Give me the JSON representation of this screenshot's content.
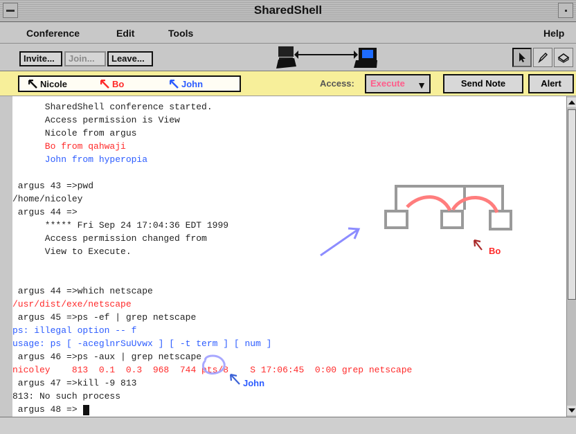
{
  "window": {
    "title": "SharedShell"
  },
  "menu": {
    "items": [
      "Conference",
      "Edit",
      "Tools",
      "Help"
    ]
  },
  "toolbar": {
    "buttons": [
      "Invite...",
      "Join...",
      "Leave..."
    ]
  },
  "participants": [
    {
      "name": "Nicole",
      "color": "#111111"
    },
    {
      "name": "Bo",
      "color": "#ff2a2a"
    },
    {
      "name": "John",
      "color": "#2c5cff"
    }
  ],
  "access": {
    "label": "Access:",
    "value": "Execute"
  },
  "buttons": {
    "send_note": "Send Note",
    "alert": "Alert"
  },
  "terminal": {
    "lines": [
      {
        "text": "      SharedShell conference started.",
        "color": "#222222"
      },
      {
        "text": "      Access permission is View",
        "color": "#222222"
      },
      {
        "text": "      Nicole from argus",
        "color": "#222222"
      },
      {
        "text": "      Bo from qahwaji",
        "color": "#ff2a2a"
      },
      {
        "text": "      John from hyperopia",
        "color": "#2c5cff"
      },
      {
        "text": "",
        "color": "#222222"
      },
      {
        "text": " argus 43 =>pwd",
        "color": "#222222"
      },
      {
        "text": "/home/nicoley",
        "color": "#222222"
      },
      {
        "text": " argus 44 =>",
        "color": "#222222"
      },
      {
        "text": "      ***** Fri Sep 24 17:04:36 EDT 1999",
        "color": "#222222"
      },
      {
        "text": "      Access permission changed from",
        "color": "#222222"
      },
      {
        "text": "      View to Execute.",
        "color": "#222222"
      },
      {
        "text": "",
        "color": "#222222"
      },
      {
        "text": "",
        "color": "#222222"
      },
      {
        "text": " argus 44 =>which netscape",
        "color": "#222222"
      },
      {
        "text": "/usr/dist/exe/netscape",
        "color": "#ff2a2a"
      },
      {
        "text": " argus 45 =>ps -ef | grep netscape",
        "color": "#222222"
      },
      {
        "text": "ps: illegal option -- f",
        "color": "#2c5cff"
      },
      {
        "text": "usage: ps [ -aceglnrSuUvwx ] [ -t term ] [ num ]",
        "color": "#2c5cff"
      },
      {
        "text": " argus 46 =>ps -aux | grep netscape",
        "color": "#222222"
      },
      {
        "text": "nicoley    813  0.1  0.3  968  744 pts/8    S 17:06:45  0:00 grep netscape",
        "color": "#ff2a2a"
      },
      {
        "text": " argus 47 =>kill -9 813",
        "color": "#222222"
      },
      {
        "text": "813: No such process",
        "color": "#222222"
      },
      {
        "text": " argus 48 =>",
        "color": "#222222"
      }
    ]
  },
  "cursors": {
    "bo": "Bo",
    "john": "John"
  },
  "icons": {
    "connection": "network-connection-icon",
    "pointer": "arrow-pointer-icon",
    "pen": "pen-icon",
    "eraser": "eraser-icon"
  }
}
